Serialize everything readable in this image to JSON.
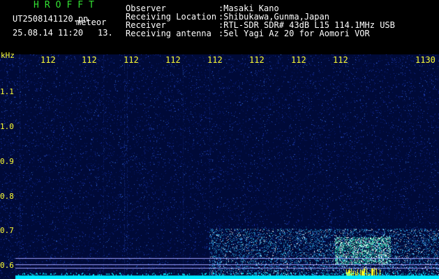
{
  "header": {
    "app_title": "HROFFT",
    "filename": "UT2508141120.pn",
    "tag": "meteor",
    "datetime": "25.08.14 11:20",
    "seq": "13."
  },
  "info": [
    {
      "label": "Observer",
      "value": ":Masaki Kano"
    },
    {
      "label": "Receiving Location",
      "value": ":Shibukawa,Gunma,Japan"
    },
    {
      "label": "Receiver",
      "value": ":RTL-SDR SDR# 43dB L15 114.1MHz USB"
    },
    {
      "label": "Receiving antenna",
      "value": ":5el Yagi Az 20 for Aomori VOR"
    }
  ],
  "axis": {
    "unit": "kHz",
    "y_ticks": [
      "1.1",
      "1.0",
      "0.9",
      "0.8",
      "0.7",
      "0.6"
    ],
    "x_ticks": [
      "112",
      "112",
      "112",
      "112",
      "112",
      "112",
      "112",
      "112",
      "1130"
    ]
  },
  "colors": {
    "label_green": "#33e033",
    "axis_yellow": "#ffff33",
    "background_blue": "#000a38",
    "signal_cyan": "#00e8ff"
  }
}
